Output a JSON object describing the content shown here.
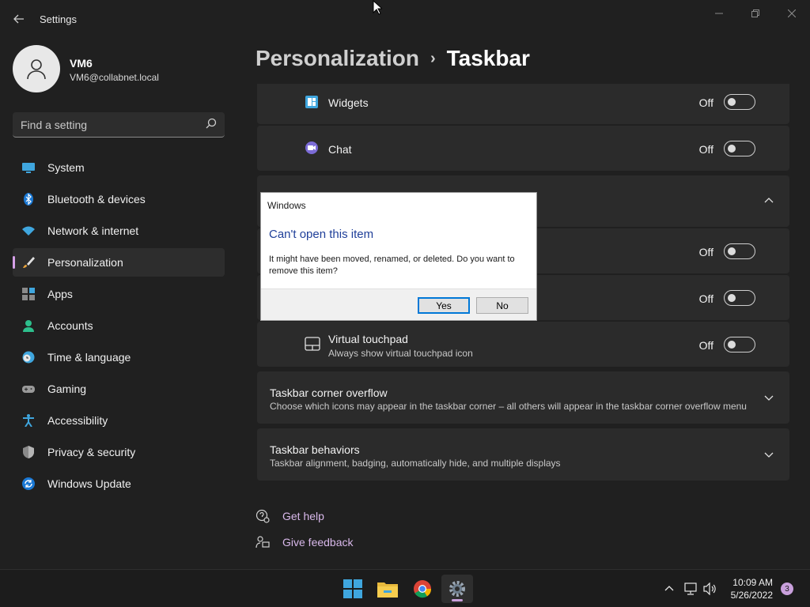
{
  "window": {
    "title": "Settings",
    "back_icon": "back-arrow-icon",
    "controls": [
      "minimize",
      "maximize",
      "close"
    ]
  },
  "user": {
    "name": "VM6",
    "email": "VM6@collabnet.local"
  },
  "search": {
    "placeholder": "Find a setting"
  },
  "sidebar": {
    "items": [
      {
        "label": "System",
        "icon": "system-icon",
        "active": false
      },
      {
        "label": "Bluetooth & devices",
        "icon": "bluetooth-icon",
        "active": false
      },
      {
        "label": "Network & internet",
        "icon": "wifi-icon",
        "active": false
      },
      {
        "label": "Personalization",
        "icon": "brush-icon",
        "active": true
      },
      {
        "label": "Apps",
        "icon": "apps-icon",
        "active": false
      },
      {
        "label": "Accounts",
        "icon": "accounts-icon",
        "active": false
      },
      {
        "label": "Time & language",
        "icon": "clock-globe-icon",
        "active": false
      },
      {
        "label": "Gaming",
        "icon": "gamepad-icon",
        "active": false
      },
      {
        "label": "Accessibility",
        "icon": "accessibility-icon",
        "active": false
      },
      {
        "label": "Privacy & security",
        "icon": "shield-icon",
        "active": false
      },
      {
        "label": "Windows Update",
        "icon": "update-icon",
        "active": false
      }
    ]
  },
  "breadcrumb": {
    "parent": "Personalization",
    "separator": "›",
    "current": "Taskbar"
  },
  "taskbar_items": {
    "widgets": {
      "label": "Widgets",
      "state": "Off"
    },
    "chat": {
      "label": "Chat",
      "state": "Off"
    }
  },
  "corner_icons": {
    "row1_state": "Off",
    "row2_state": "Off",
    "virtual_touchpad": {
      "label": "Virtual touchpad",
      "description": "Always show virtual touchpad icon",
      "state": "Off"
    }
  },
  "sections": {
    "corner_overflow": {
      "title": "Taskbar corner overflow",
      "description": "Choose which icons may appear in the taskbar corner – all others will appear in the taskbar corner overflow menu"
    },
    "behaviors": {
      "title": "Taskbar behaviors",
      "description": "Taskbar alignment, badging, automatically hide, and multiple displays"
    }
  },
  "help": {
    "get_help": "Get help",
    "give_feedback": "Give feedback"
  },
  "dialog": {
    "title": "Windows",
    "heading": "Can't open this item",
    "body": "It might have been moved, renamed, or deleted. Do you want to remove this item?",
    "yes": "Yes",
    "no": "No"
  },
  "system_taskbar": {
    "apps": [
      "start-icon",
      "file-explorer-icon",
      "chrome-icon",
      "settings-icon"
    ],
    "time": "10:09 AM",
    "date": "5/26/2022",
    "notification_count": "3"
  },
  "colors": {
    "accent": "#c9a0dc",
    "background": "#202020",
    "card": "#2b2b2b",
    "dialog_heading": "#1f3f99"
  }
}
